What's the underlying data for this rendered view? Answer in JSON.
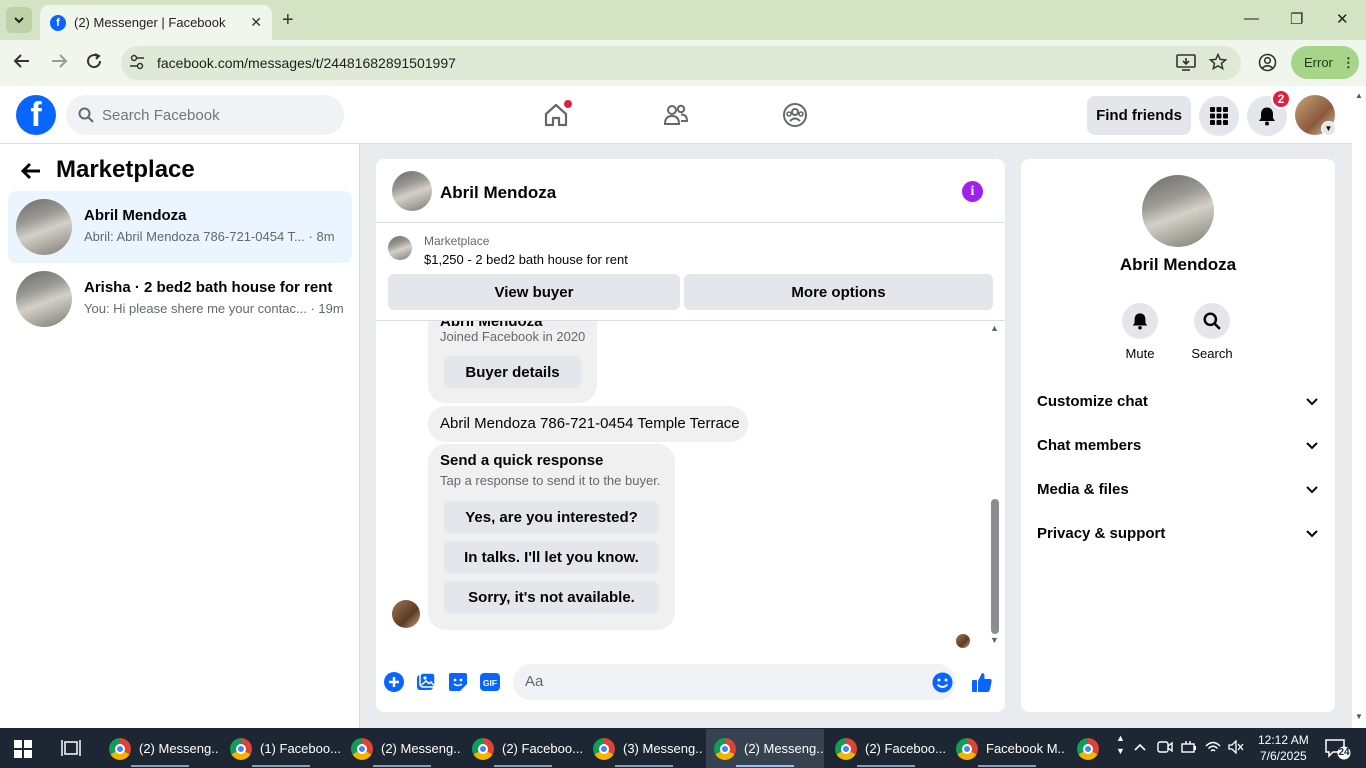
{
  "browser": {
    "tab_title": "(2) Messenger | Facebook",
    "url": "facebook.com/messages/t/24481682891501997",
    "error_label": "Error"
  },
  "header": {
    "search_placeholder": "Search Facebook",
    "find_friends": "Find friends",
    "notifications_count": "2"
  },
  "sidebar": {
    "title": "Marketplace",
    "conversations": [
      {
        "name": "Abril Mendoza",
        "snippet": "Abril: Abril Mendoza 786-721-0454 T...",
        "time": "· 8m",
        "active": true
      },
      {
        "name": "Arisha · 2 bed2 bath house for rent",
        "snippet": "You: Hi please shere me your contac...",
        "time": "· 19m",
        "active": false
      }
    ]
  },
  "chat": {
    "contact_name": "Abril Mendoza",
    "listing_source": "Marketplace",
    "listing_title": "$1,250 - 2 bed2 bath house for rent",
    "view_buyer": "View buyer",
    "more_options": "More options",
    "card_name": "Abril Mendoza",
    "joined": "Joined Facebook in 2020",
    "buyer_details": "Buyer details",
    "message": "Abril Mendoza 786-721-0454 Temple Terrace",
    "quick_title": "Send a quick response",
    "quick_sub": "Tap a response to send it to the buyer.",
    "quick_responses": [
      "Yes, are you interested?",
      "In talks. I'll let you know.",
      "Sorry, it's not available."
    ],
    "composer_placeholder": "Aa"
  },
  "info_panel": {
    "name": "Abril Mendoza",
    "mute": "Mute",
    "search": "Search",
    "sections": [
      "Customize chat",
      "Chat members",
      "Media & files",
      "Privacy & support"
    ]
  },
  "taskbar": {
    "items": [
      "(2) Messeng...",
      "(1) Faceboo...",
      "(2) Messeng...",
      "(2) Faceboo...",
      "(3) Messeng...",
      "(2) Messeng...",
      "(2) Faceboo...",
      "Facebook M..."
    ],
    "time": "12:12 AM",
    "date": "7/6/2025",
    "notif_count": "24"
  },
  "colors": {
    "facebook_blue": "#0866ff",
    "badge_red": "#e41e3f",
    "info_purple": "#a020f0",
    "active_conversation": "#ebf5ff"
  }
}
